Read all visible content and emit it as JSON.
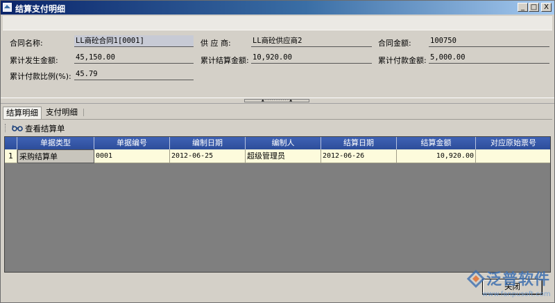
{
  "window": {
    "title": "结算支付明细",
    "btn_min": "_",
    "btn_max": "□",
    "btn_close": "X"
  },
  "info": {
    "contract_name_label": "合同名称:",
    "contract_name_value": "LL商砼合同1[0001]",
    "supplier_label": "供 应 商:",
    "supplier_value": "LL商砼供应商2",
    "contract_amount_label": "合同金额:",
    "contract_amount_value": "100750",
    "cum_incurred_label": "累计发生金额:",
    "cum_incurred_value": "45,150.00",
    "cum_settled_label": "累计结算金额:",
    "cum_settled_value": "10,920.00",
    "cum_paid_label": "累计付款金额:",
    "cum_paid_value": "5,000.00",
    "pay_ratio_label": "累计付款比例(%):",
    "pay_ratio_value": "45.79"
  },
  "tabs": [
    {
      "label": "结算明细",
      "active": true
    },
    {
      "label": "支付明细",
      "active": false
    }
  ],
  "toolbar": {
    "view_label": "查看结算单",
    "icon": "view-glasses-icon"
  },
  "table": {
    "columns": [
      "单据类型",
      "单据编号",
      "编制日期",
      "编制人",
      "结算日期",
      "结算金额",
      "对应原始票号"
    ],
    "rows": [
      {
        "num": "1",
        "type": "采购结算单",
        "code": "0001",
        "date": "2012-06-25",
        "author": "超级管理员",
        "settle_date": "2012-06-26",
        "amount": "10,920.00",
        "invoice": ""
      }
    ]
  },
  "footer": {
    "close_label": "关闭"
  },
  "watermark": {
    "text": "泛普软件",
    "url": "www.fanpusoft.com"
  },
  "colors": {
    "header_blue": "#2d4d9a",
    "row_yellow": "#fdfbdc",
    "watermark_blue": "#3d6fb0"
  }
}
